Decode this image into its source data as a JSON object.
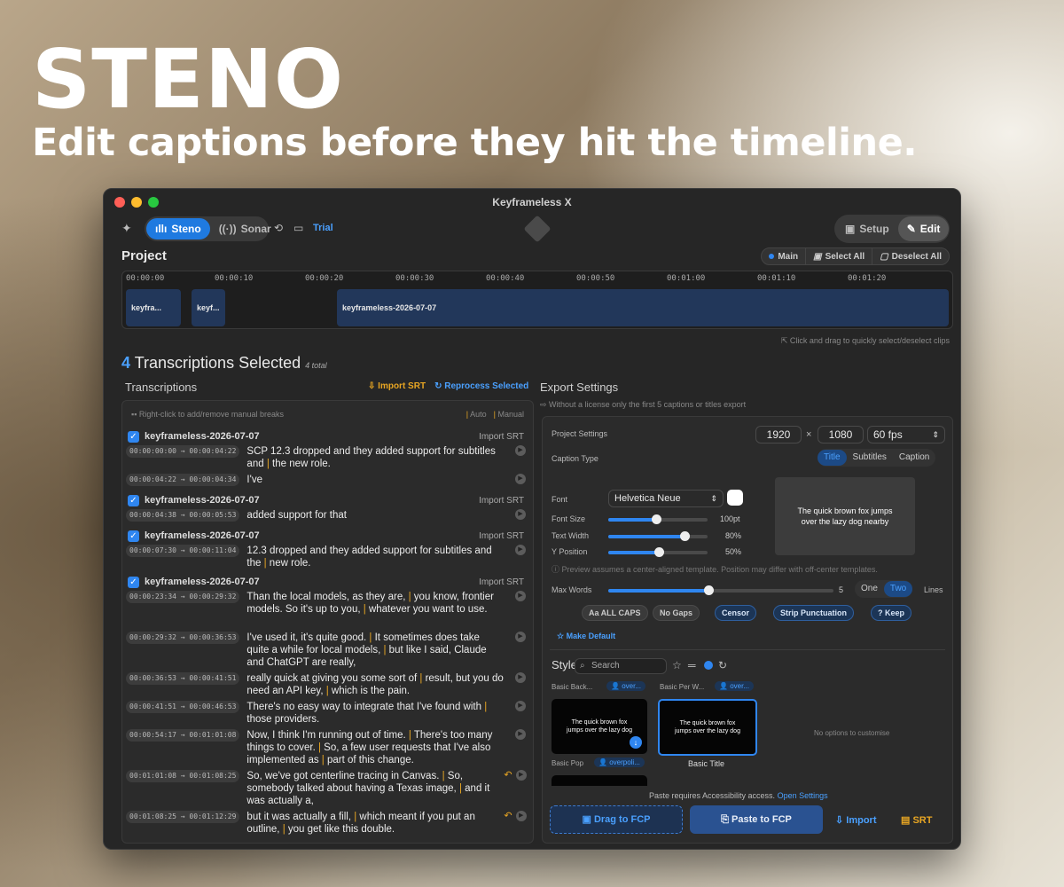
{
  "hero": {
    "title": "STENO",
    "subtitle": "Edit captions before they hit the timeline."
  },
  "window": {
    "title": "Keyframeless X"
  },
  "toolbar": {
    "steno": "Steno",
    "sonar": "Sonar",
    "trial": "Trial",
    "setup": "Setup",
    "edit": "Edit"
  },
  "project": {
    "label": "Project",
    "main": "Main",
    "select_all": "Select All",
    "deselect_all": "Deselect All",
    "ticks": [
      "00:00:00",
      "00:00:10",
      "00:00:20",
      "00:00:30",
      "00:00:40",
      "00:00:50",
      "00:01:00",
      "00:01:10",
      "00:01:20"
    ],
    "clips": [
      "keyfra...",
      "keyf...",
      "keyframeless-2026-07-07"
    ],
    "hint": "Click and drag to quickly select/deselect clips"
  },
  "selection": {
    "count": "4",
    "label": "Transcriptions Selected",
    "total": "4 total"
  },
  "transcriptions": {
    "label": "Transcriptions",
    "import_srt": "Import SRT",
    "reprocess": "Reprocess Selected",
    "hint": "Right-click to add/remove manual breaks",
    "auto": "Auto",
    "manual": "Manual",
    "clip_name": "keyframeless-2026-07-07",
    "clip_import": "Import SRT",
    "segments": [
      {
        "tc": "00:00:00:00 → 00:00:04:22",
        "a": "SCP 12.3 dropped and they added support for subtitles and ",
        "b": " the new role."
      },
      {
        "tc": "00:00:04:22 → 00:00:04:34",
        "a": "I've",
        "b": ""
      },
      {
        "tc": "00:00:04:38 → 00:00:05:53",
        "a": "added support for that",
        "b": ""
      },
      {
        "tc": "00:00:07:30 → 00:00:11:04",
        "a": "12.3 dropped and they added support for subtitles and the ",
        "b": " new role."
      },
      {
        "tc": "00:00:23:34 → 00:00:29:32",
        "a": "Than the local models, as they are, ",
        "b": " you know, frontier models. So it's up to you, ",
        "c": " whatever you want to use."
      },
      {
        "tc": "00:00:29:32 → 00:00:36:53",
        "a": "I've used it, it's quite good. ",
        "b": " It sometimes does take quite a while for local models, ",
        "c": " but like I said, Claude and ChatGPT are really,"
      },
      {
        "tc": "00:00:36:53 → 00:00:41:51",
        "a": "really quick at giving you some sort of ",
        "b": " result, but you do need an API key, ",
        "c": " which is the pain."
      },
      {
        "tc": "00:00:41:51 → 00:00:46:53",
        "a": "There's no easy way to integrate that I've found with ",
        "b": " those providers."
      },
      {
        "tc": "00:00:54:17 → 00:01:01:08",
        "a": "Now, I think I'm running out of time. ",
        "b": " There's too many things to cover. ",
        "c": " So, a few user requests that I've also implemented as ",
        "d": " part of this change."
      },
      {
        "tc": "00:01:01:08 → 00:01:08:25",
        "a": "So, we've got centerline tracing in Canvas. ",
        "b": " So, somebody talked about having a Texas image, ",
        "c": " and it was actually a,"
      },
      {
        "tc": "00:01:08:25 → 00:01:12:29",
        "a": "but it was actually a fill, ",
        "b": " which meant if you put an outline, ",
        "c": " you get like this double."
      }
    ]
  },
  "export": {
    "label": "Export Settings",
    "hint": "Without a license only the first 5 captions or titles export",
    "project_settings": "Project Settings",
    "width": "1920",
    "x": "×",
    "height": "1080",
    "fps": "60 fps",
    "caption_type": "Caption Type",
    "types": [
      "Title",
      "Subtitles",
      "Caption"
    ],
    "font_label": "Font",
    "font": "Helvetica Neue",
    "font_size": "Font Size",
    "font_size_val": "100pt",
    "text_width": "Text Width",
    "text_width_val": "80%",
    "y_position": "Y Position",
    "y_position_val": "50%",
    "preview_text": "The quick brown fox jumps over the lazy dog nearby",
    "preview_note": "Preview assumes a center-aligned template. Position may differ with off-center templates.",
    "max_words": "Max Words",
    "max_words_val": "5",
    "lines": [
      "One",
      "Two"
    ],
    "lines_label": "Lines",
    "chips": [
      "Aa ALL CAPS",
      "No Gaps",
      "Censor",
      "Strip Punctuation",
      "? Keep"
    ],
    "make_default": "Make Default",
    "style_label": "Style",
    "search_placeholder": "Search",
    "styles": [
      {
        "name": "Basic Back...",
        "tag": "over..."
      },
      {
        "name": "Basic Per W...",
        "tag": "over..."
      }
    ],
    "basic_title": "Basic Title",
    "basic_pop": "Basic Pop",
    "basic_pop_tag": "overpoli...",
    "thumb_text": "The quick brown fox jumps over the lazy dog",
    "no_options": "No options to customise",
    "paste_note": "Paste requires Accessibility access.",
    "open_settings": "Open Settings",
    "drag": "Drag to FCP",
    "paste": "Paste to FCP",
    "import": "Import",
    "srt": "SRT"
  },
  "colors": {
    "accent": "#2f86f0",
    "warning": "#e8a623",
    "window_bg": "#262626"
  }
}
